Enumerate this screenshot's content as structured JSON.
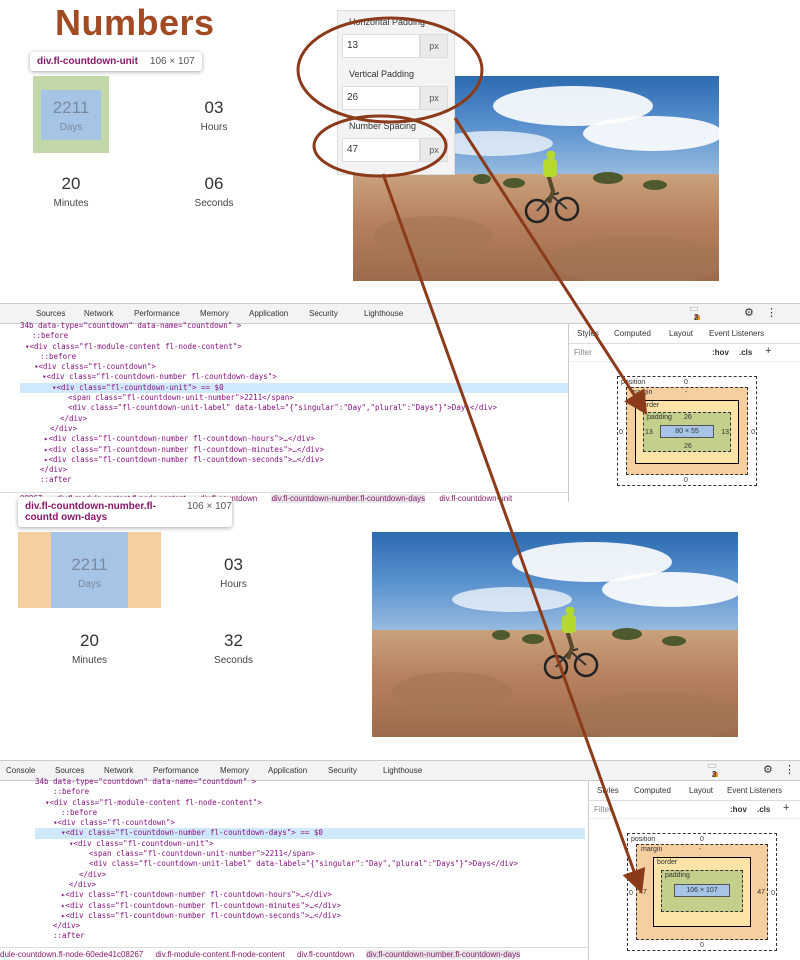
{
  "title": "Numbers",
  "top": {
    "tooltip_selector": "div.fl-countdown-unit",
    "tooltip_dims": "106 × 107",
    "units": [
      {
        "number": "2211",
        "label": "Days"
      },
      {
        "number": "03",
        "label": "Hours"
      },
      {
        "number": "20",
        "label": "Minutes"
      },
      {
        "number": "06",
        "label": "Seconds"
      }
    ]
  },
  "settings_panel": {
    "fields": [
      {
        "label": "Horizontal Padding",
        "value": "13",
        "unit": "px"
      },
      {
        "label": "Vertical Padding",
        "value": "26",
        "unit": "px"
      },
      {
        "label": "Number Spacing",
        "value": "47",
        "unit": "px"
      }
    ]
  },
  "devtools1": {
    "tabs": [
      "Sources",
      "Network",
      "Performance",
      "Memory",
      "Application",
      "Security",
      "Lighthouse"
    ],
    "errors": "2",
    "warnings": "3",
    "code_lines": [
      "34b  data-type=\"countdown\" data-name=\"countdown\" >",
      "::before",
      "▾<div class=\"fl-module-content fl-node-content\">",
      "::before",
      "▾<div class=\"fl-countdown\">",
      "▾<div class=\"fl-countdown-number fl-countdown-days\">",
      "▾<div class=\"fl-countdown-unit\"> == $0",
      "<span class=\"fl-countdown-unit-number\">2211</span>",
      "<div class=\"fl-countdown-unit-label\" data-label=\"{\"singular\":\"Day\",\"plural\":\"Days\"}\">Days</div>",
      "</div>",
      "</div>",
      "▸<div class=\"fl-countdown-number fl-countdown-hours\">…</div>",
      "▸<div class=\"fl-countdown-number fl-countdown-minutes\">…</div>",
      "▸<div class=\"fl-countdown-number fl-countdown-seconds\">…</div>",
      "</div>",
      "::after"
    ],
    "breadcrumbs": [
      "08267",
      "div.fl-module-content.fl-node-content",
      "div.fl-countdown",
      "div.fl-countdown-number.fl-countdown-days",
      "div.fl-countdown-unit"
    ],
    "style_tabs": [
      "Styles",
      "Computed",
      "Layout",
      "Event Listeners"
    ],
    "filter_placeholder": "Filter",
    "hov": ":hov",
    "cls": ".cls",
    "boxmodel": {
      "position": "position",
      "position_val": "0",
      "margin": "margin",
      "margin_val": "-",
      "border": "border",
      "border_val": "-",
      "padding": "padding",
      "padding_top": "26",
      "padding_bottom": "26",
      "padding_left": "13",
      "padding_right": "13",
      "content": "80 × 55",
      "left": "0",
      "right": "0",
      "bottom": "0"
    }
  },
  "middle": {
    "tooltip_selector": "div.fl-countdown-number.fl-countd own-days",
    "tooltip_dims": "106 × 107",
    "units": [
      {
        "number": "2211",
        "label": "Days"
      },
      {
        "number": "03",
        "label": "Hours"
      },
      {
        "number": "20",
        "label": "Minutes"
      },
      {
        "number": "32",
        "label": "Seconds"
      }
    ]
  },
  "devtools2": {
    "tabs": [
      "Console",
      "Sources",
      "Network",
      "Performance",
      "Memory",
      "Application",
      "Security",
      "Lighthouse"
    ],
    "errors": "2",
    "warnings": "3",
    "code_lines": [
      "34b  data-type=\"countdown\" data-name=\"countdown\" >",
      "::before",
      "▾<div class=\"fl-module-content fl-node-content\">",
      "::before",
      "▾<div class=\"fl-countdown\">",
      "▾<div class=\"fl-countdown-number fl-countdown-days\"> == $0",
      "▾<div class=\"fl-countdown-unit\">",
      "<span class=\"fl-countdown-unit-number\">2211</span>",
      "<div class=\"fl-countdown-unit-label\" data-label=\"{\"singular\":\"Day\",\"plural\":\"Days\"}\">Days</div>",
      "</div>",
      "</div>",
      "▸<div class=\"fl-countdown-number fl-countdown-hours\">…</div>",
      "▸<div class=\"fl-countdown-number fl-countdown-minutes\">…</div>",
      "▸<div class=\"fl-countdown-number fl-countdown-seconds\">…</div>",
      "</div>",
      "::after"
    ],
    "breadcrumbs": [
      "dule-countdown.fl-node-60ede41c08267",
      "div.fl-module-content.fl-node-content",
      "div.fl-countdown",
      "div.fl-countdown-number.fl-countdown-days"
    ],
    "style_tabs": [
      "Styles",
      "Computed",
      "Layout",
      "Event Listeners"
    ],
    "filter_placeholder": "Filter",
    "hov": ":hov",
    "cls": ".cls",
    "boxmodel": {
      "position": "position",
      "position_val": "0",
      "margin": "margin",
      "margin_left": "47",
      "margin_right": "47",
      "margin_val": "-",
      "border": "border",
      "border_val": "-",
      "padding": "padding",
      "padding_val": "-",
      "content": "106 × 107",
      "left": "0",
      "right": "0",
      "bottom": "0"
    }
  },
  "colors": {
    "accent": "#a14a24",
    "arrow": "#8b3a1a",
    "padding": "#c3d08b",
    "margin": "#f6cfa0",
    "content": "#a6c4e6",
    "selection": "#cfe8fc"
  }
}
